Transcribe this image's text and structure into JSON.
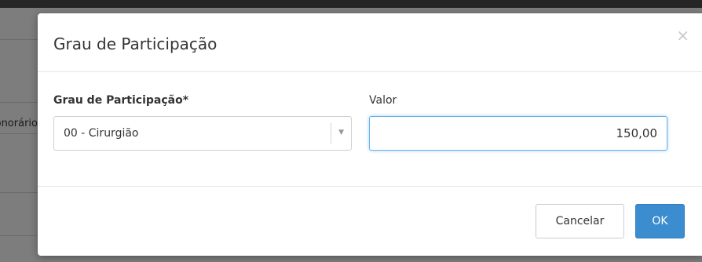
{
  "background": {
    "column_label": "Honorário"
  },
  "modal": {
    "title": "Grau de Participação",
    "close_symbol": "×",
    "participation": {
      "label": "Grau de Participação*",
      "selected": "00 - Cirurgião",
      "arrow": "▼"
    },
    "value": {
      "label": "Valor",
      "current": "150,00"
    },
    "buttons": {
      "cancel": "Cancelar",
      "ok": "OK"
    }
  },
  "colors": {
    "primary": "#3c8dcf",
    "focus_border": "#66afe9",
    "overlay": "#7d7d7d"
  }
}
